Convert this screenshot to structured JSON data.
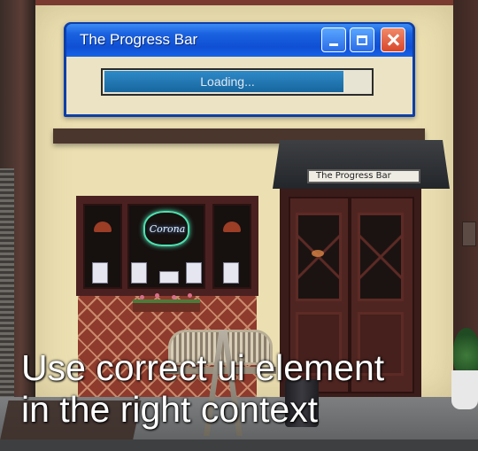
{
  "window": {
    "title": "The Progress Bar",
    "progress_label": "Loading...",
    "progress_fraction": 0.9,
    "buttons": {
      "minimize": "minimize-icon",
      "maximize": "maximize-icon",
      "close": "close-icon"
    }
  },
  "storefront": {
    "awning_sign": "The Progress Bar",
    "neon_sign": "Corona"
  },
  "caption": {
    "line1": "Use correct ui element",
    "line2": "in the right context"
  },
  "colors": {
    "titlebar": "#1a62e0",
    "window_border": "#0d3ea8",
    "close_button": "#d8462a",
    "progress_fill": "#17669e",
    "facade": "#ece0b2",
    "awning": "#2c2f33"
  }
}
